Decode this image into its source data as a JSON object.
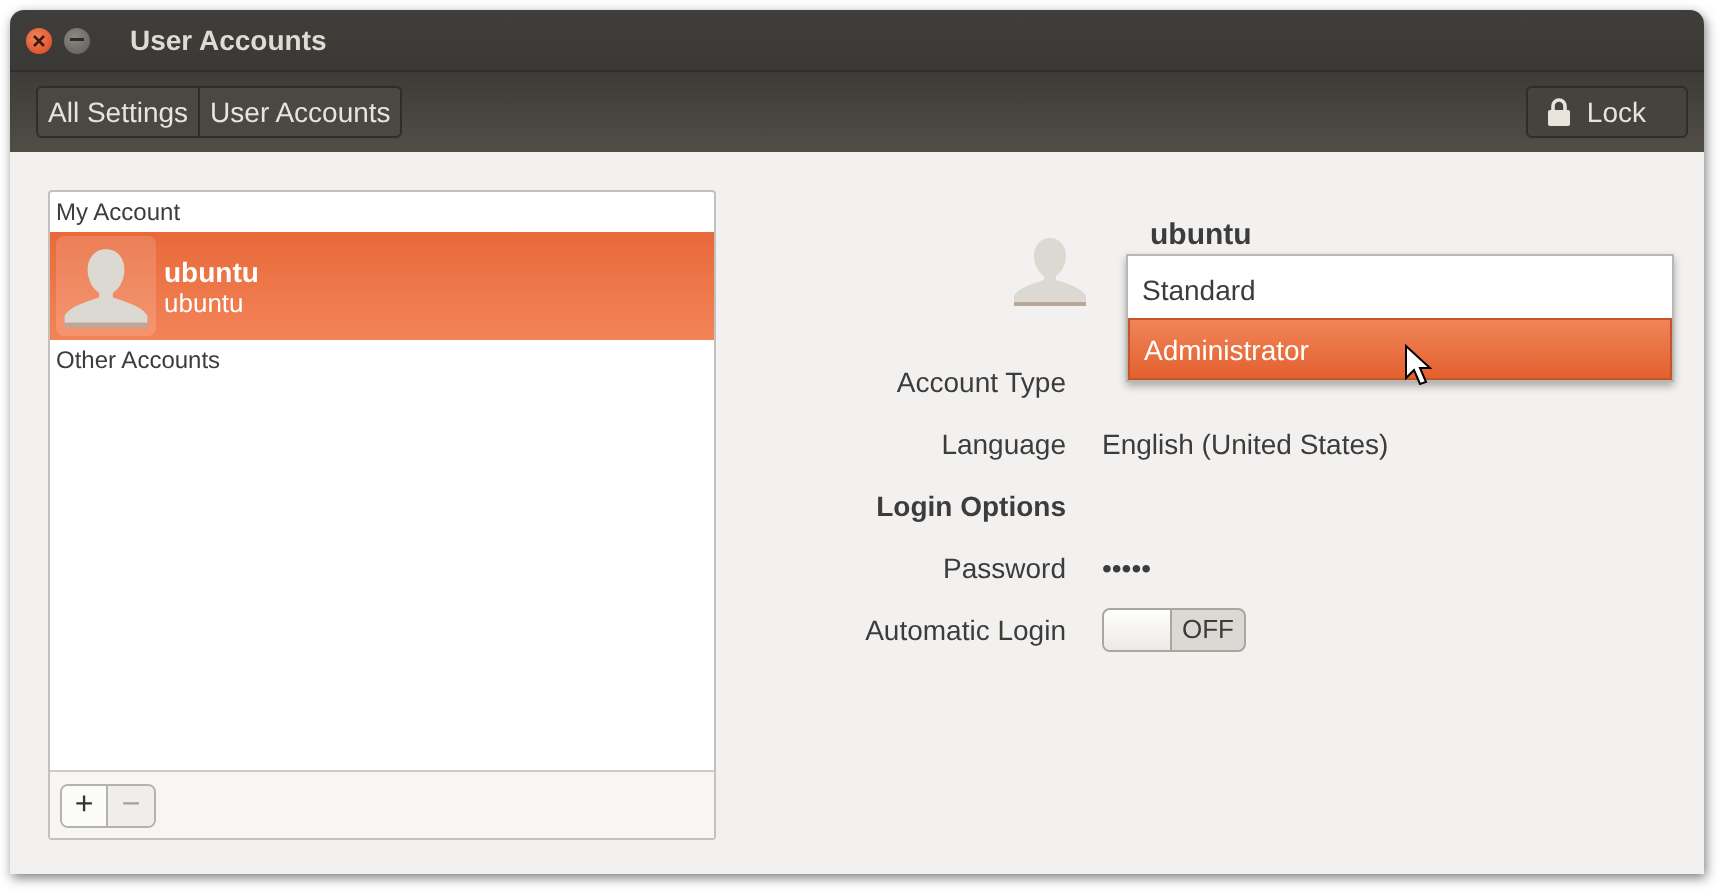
{
  "window": {
    "title": "User Accounts"
  },
  "breadcrumbs": [
    {
      "label": "All Settings",
      "selected": false
    },
    {
      "label": "User Accounts",
      "selected": false
    }
  ],
  "lock_button": {
    "label": "Lock"
  },
  "accounts": {
    "sections": [
      {
        "heading": "My Account",
        "users": [
          {
            "name": "ubuntu",
            "username": "ubuntu",
            "selected": true
          }
        ]
      },
      {
        "heading": "Other Accounts"
      }
    ],
    "add_button": {
      "label": "+",
      "disabled": false
    },
    "remove_button": {
      "label": "−",
      "disabled": true
    }
  },
  "details": {
    "name": "ubuntu",
    "rows": [
      {
        "kind": "combo",
        "label": "Account Type"
      },
      {
        "kind": "text",
        "label": "Language",
        "value": "English (United States)"
      },
      {
        "kind": "heading",
        "label": "Login Options"
      },
      {
        "kind": "text",
        "label": "Password",
        "value": "•••••"
      },
      {
        "kind": "switch",
        "label": "Automatic Login",
        "on": false,
        "off_label": "OFF"
      }
    ],
    "account_type_menu": [
      {
        "label": "Standard",
        "selected": false
      },
      {
        "label": "Administrator",
        "selected": true
      }
    ]
  }
}
